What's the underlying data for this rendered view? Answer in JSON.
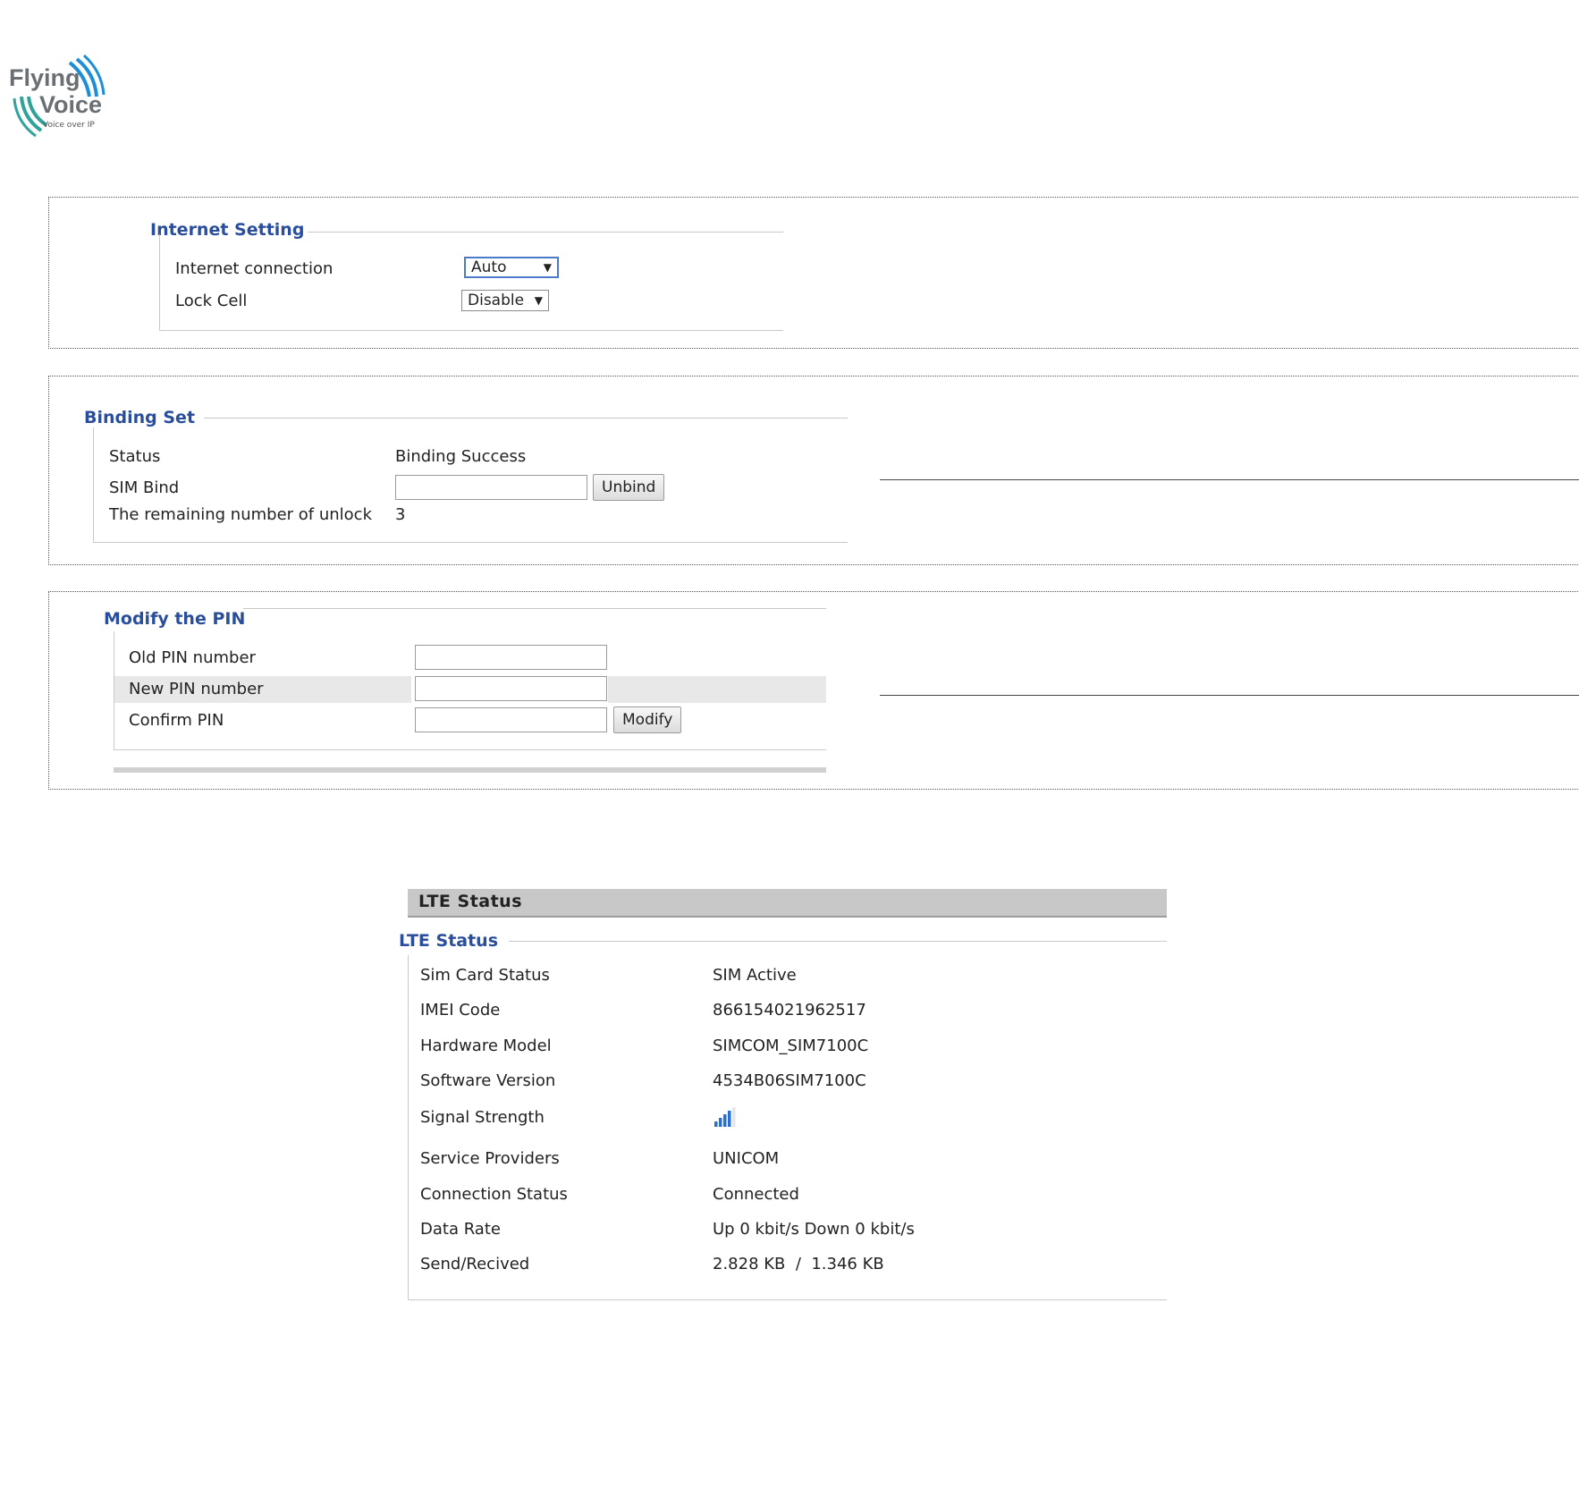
{
  "brand": {
    "logo_line1": "Flying",
    "logo_line2": "Voice",
    "logo_tagline": "Voice over IP",
    "colors": {
      "blue": "#1e8fd6",
      "teal": "#2fa39a",
      "grey": "#6a6f73"
    }
  },
  "internet_setting": {
    "title": "Internet Setting",
    "connection_label": "Internet connection",
    "connection_value": "Auto",
    "lock_cell_label": "Lock Cell",
    "lock_cell_value": "Disable"
  },
  "binding_set": {
    "title": "Binding Set",
    "status_label": "Status",
    "status_value": "Binding Success",
    "sim_bind_label": "SIM Bind",
    "sim_bind_value": "",
    "unbind_label": "Unbind",
    "remaining_label": "The remaining number of unlock",
    "remaining_value": "3"
  },
  "modify_pin": {
    "title": "Modify the PIN",
    "old_pin_label": "Old PIN number",
    "new_pin_label": "New PIN number",
    "confirm_pin_label": "Confirm PIN",
    "modify_label": "Modify"
  },
  "lte_status": {
    "header": "LTE Status",
    "title": "LTE Status",
    "rows": [
      {
        "label": "Sim Card Status",
        "value": "SIM Active"
      },
      {
        "label": "IMEI Code",
        "value": "866154021962517"
      },
      {
        "label": "Hardware Model",
        "value": "SIMCOM_SIM7100C"
      },
      {
        "label": "Software Version",
        "value": "4534B06SIM7100C"
      },
      {
        "label": "Signal Strength",
        "value": ""
      },
      {
        "label": "Service Providers",
        "value": "UNICOM"
      },
      {
        "label": "Connection Status",
        "value": "Connected"
      },
      {
        "label": "Data Rate",
        "value": "Up 0 kbit/s Down 0 kbit/s"
      },
      {
        "label": "Send/Recived",
        "value": "2.828 KB  /  1.346 KB"
      }
    ],
    "signal_bars": 4,
    "signal_color": "#2a6fc9"
  }
}
